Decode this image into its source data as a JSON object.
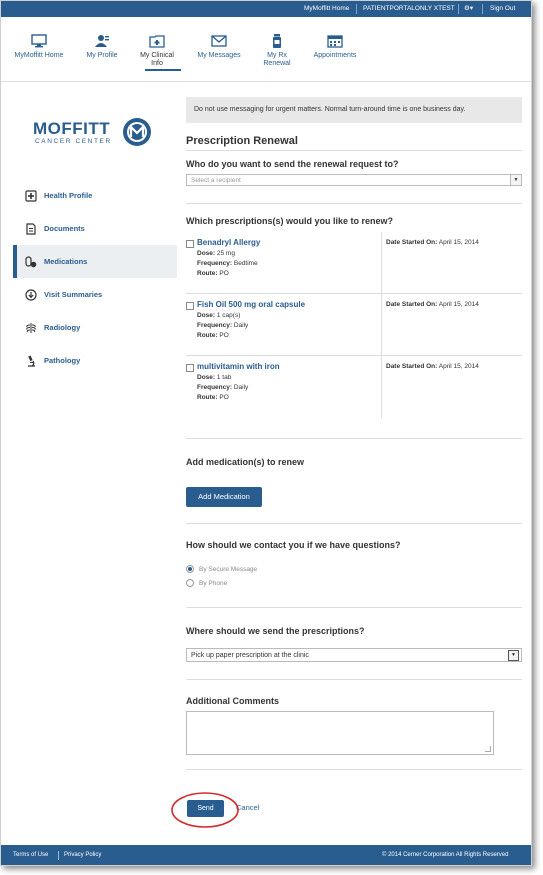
{
  "topbar": {
    "home": "MyMoffitt Home",
    "user": "PATIENTPORTALONLY XTEST",
    "settings": "⚙▾",
    "signout": "Sign Out"
  },
  "nav": [
    {
      "label": "MyMoffitt Home",
      "icon": "monitor-icon"
    },
    {
      "label": "My Profile",
      "icon": "user-profile-icon"
    },
    {
      "label": "My Clinical Info",
      "icon": "medical-folder-icon",
      "active": true
    },
    {
      "label": "My Messages",
      "icon": "envelope-icon"
    },
    {
      "label": "My Rx Renewal",
      "icon": "pill-bottle-icon"
    },
    {
      "label": "Appointments",
      "icon": "calendar-icon"
    }
  ],
  "logo": {
    "name": "MOFFITT",
    "sub": "CANCER CENTER"
  },
  "sidebar": [
    {
      "label": "Health Profile",
      "icon": "plus-box-icon"
    },
    {
      "label": "Documents",
      "icon": "document-icon"
    },
    {
      "label": "Medications",
      "icon": "pills-icon",
      "active": true
    },
    {
      "label": "Visit Summaries",
      "icon": "download-circle-icon"
    },
    {
      "label": "Radiology",
      "icon": "ribcage-icon"
    },
    {
      "label": "Pathology",
      "icon": "microscope-icon"
    }
  ],
  "main": {
    "alert": "Do not use messaging for urgent matters. Normal turn-around time is one business day.",
    "title": "Prescription Renewal",
    "q_recipient": "Who do you want to send the renewal request to?",
    "recipient_placeholder": "Select a recipient",
    "q_which": "Which prescriptions(s) would you like to renew?",
    "dose_label": "Dose:",
    "freq_label": "Frequency:",
    "route_label": "Route:",
    "date_label": "Date Started On:",
    "prescriptions": [
      {
        "name": "Benadryl Allergy",
        "dose": "25 mg",
        "frequency": "Bedtime",
        "route": "PO",
        "date": "April 15, 2014"
      },
      {
        "name": "Fish Oil 500 mg oral capsule",
        "dose": "1 cap(s)",
        "frequency": "Daily",
        "route": "PO",
        "date": "April 15, 2014"
      },
      {
        "name": "multivitamin with iron",
        "dose": "1 tab",
        "frequency": "Daily",
        "route": "PO",
        "date": "April 15, 2014"
      }
    ],
    "add_med_heading": "Add medication(s) to renew",
    "add_med_button": "Add Medication",
    "q_contact": "How should we contact you if we have questions?",
    "contact_secure": "By Secure Message",
    "contact_phone": "By Phone",
    "q_where": "Where should we send the prescriptions?",
    "where_value": "Pick up paper prescription at the clinic",
    "comments_heading": "Additional Comments",
    "send": "Send",
    "cancel": "Cancel"
  },
  "footer": {
    "terms": "Terms of Use",
    "privacy": "Privacy Policy",
    "copyright": "© 2014 Cerner Corporation All Rights Reserved"
  },
  "colors": {
    "brand": "#2a5d8f",
    "annotation": "#d22a2a"
  }
}
